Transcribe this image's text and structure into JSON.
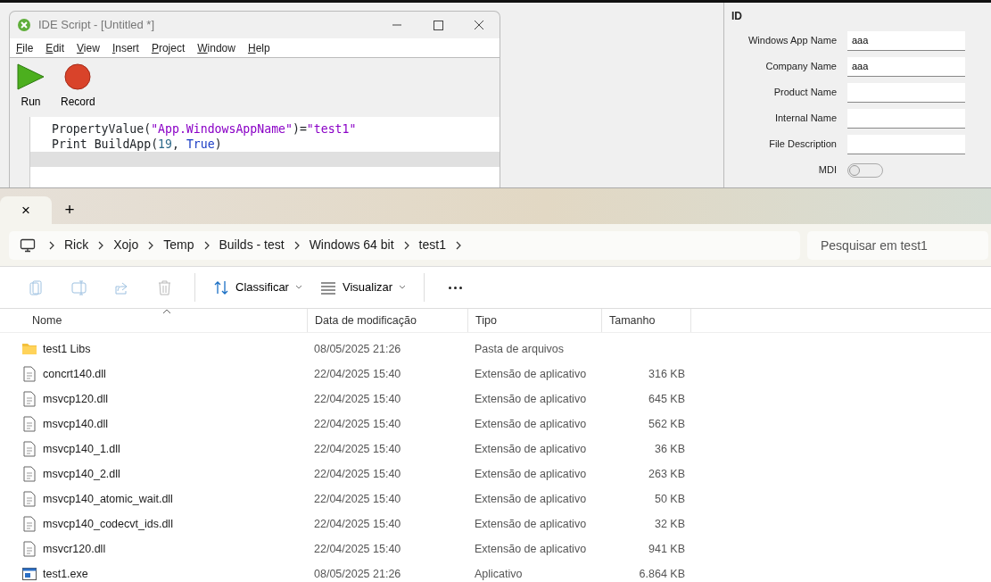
{
  "ide_window": {
    "title": "IDE Script - [Untitled *]",
    "menu": [
      "File",
      "Edit",
      "View",
      "Insert",
      "Project",
      "Window",
      "Help"
    ],
    "toolbar": [
      {
        "label": "Run",
        "kind": "run"
      },
      {
        "label": "Record",
        "kind": "record"
      }
    ],
    "code_lines": [
      {
        "current": false,
        "tokens": [
          {
            "text": "PropertyValue(",
            "kind": "plain"
          },
          {
            "text": "\"App.WindowsAppName\"",
            "kind": "string"
          },
          {
            "text": ")=",
            "kind": "plain"
          },
          {
            "text": "\"test1\"",
            "kind": "string"
          }
        ]
      },
      {
        "current": false,
        "tokens": [
          {
            "text": "Print BuildApp(",
            "kind": "plain"
          },
          {
            "text": "19",
            "kind": "number"
          },
          {
            "text": ", ",
            "kind": "plain"
          },
          {
            "text": "True",
            "kind": "keyword"
          },
          {
            "text": ")",
            "kind": "plain"
          }
        ]
      },
      {
        "current": true
      }
    ]
  },
  "inspector": {
    "section": "ID",
    "fields": [
      {
        "label": "Windows App Name",
        "value": "aaa",
        "kind": "text"
      },
      {
        "label": "Company Name",
        "value": "aaa",
        "kind": "text"
      },
      {
        "label": "Product Name",
        "kind": "text"
      },
      {
        "label": "Internal Name",
        "kind": "text"
      },
      {
        "label": "File Description",
        "kind": "text"
      },
      {
        "label": "MDI",
        "kind": "switch",
        "on": false
      }
    ]
  },
  "explorer": {
    "tab_close": "×",
    "new_tab": "+",
    "breadcrumb": [
      "Rick",
      "Xojo",
      "Temp",
      "Builds - test",
      "Windows 64 bit",
      "test1"
    ],
    "search": {
      "placeholder": "Pesquisar em test1"
    },
    "toolbar": [
      {
        "kind": "copy",
        "disabled": true
      },
      {
        "kind": "rename",
        "disabled": true
      },
      {
        "kind": "share",
        "disabled": true
      },
      {
        "kind": "delete",
        "disabled": true
      },
      {
        "kind": "sort",
        "label": "Classificar",
        "disabled": false
      },
      {
        "kind": "view",
        "label": "Visualizar",
        "disabled": false
      },
      {
        "kind": "more",
        "disabled": false
      }
    ],
    "columns": [
      "Nome",
      "Data de modificação",
      "Tipo",
      "Tamanho"
    ],
    "rows": [
      {
        "kind": "folder",
        "name": "test1 Libs",
        "date": "08/05/2025 21:26",
        "type": "Pasta de arquivos"
      },
      {
        "kind": "dll",
        "name": "concrt140.dll",
        "date": "22/04/2025 15:40",
        "type": "Extensão de aplicativo",
        "size": "316 KB"
      },
      {
        "kind": "dll",
        "name": "msvcp120.dll",
        "date": "22/04/2025 15:40",
        "type": "Extensão de aplicativo",
        "size": "645 KB"
      },
      {
        "kind": "dll",
        "name": "msvcp140.dll",
        "date": "22/04/2025 15:40",
        "type": "Extensão de aplicativo",
        "size": "562 KB"
      },
      {
        "kind": "dll",
        "name": "msvcp140_1.dll",
        "date": "22/04/2025 15:40",
        "type": "Extensão de aplicativo",
        "size": "36 KB"
      },
      {
        "kind": "dll",
        "name": "msvcp140_2.dll",
        "date": "22/04/2025 15:40",
        "type": "Extensão de aplicativo",
        "size": "263 KB"
      },
      {
        "kind": "dll",
        "name": "msvcp140_atomic_wait.dll",
        "date": "22/04/2025 15:40",
        "type": "Extensão de aplicativo",
        "size": "50 KB"
      },
      {
        "kind": "dll",
        "name": "msvcp140_codecvt_ids.dll",
        "date": "22/04/2025 15:40",
        "type": "Extensão de aplicativo",
        "size": "32 KB"
      },
      {
        "kind": "dll",
        "name": "msvcr120.dll",
        "date": "22/04/2025 15:40",
        "type": "Extensão de aplicativo",
        "size": "941 KB"
      },
      {
        "kind": "exe",
        "name": "test1.exe",
        "date": "08/05/2025 21:26",
        "type": "Aplicativo",
        "size": "6.864 KB"
      }
    ]
  }
}
